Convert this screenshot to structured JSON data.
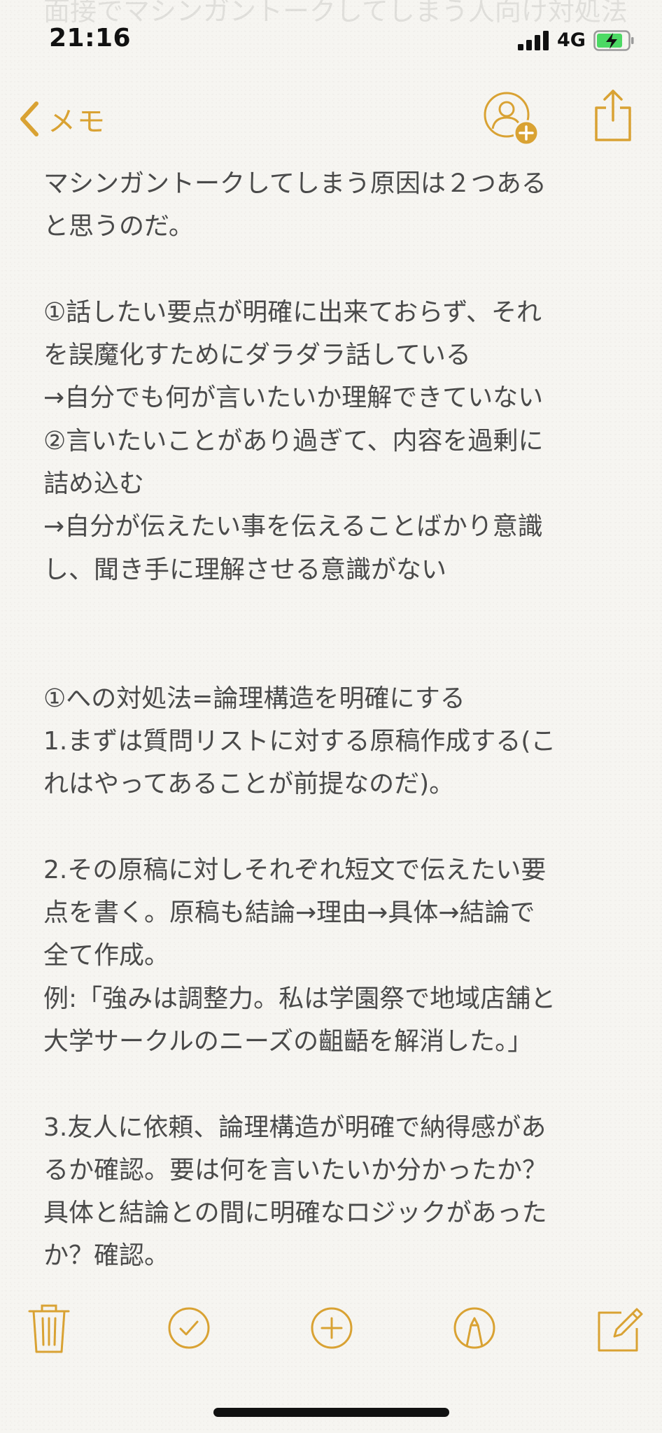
{
  "background_title": "面接でマシンガントークしてしまう人向け対処法",
  "status_bar": {
    "time": "21:16",
    "network": "4G"
  },
  "nav": {
    "back_label": "メモ",
    "accent_color": "#d9a233"
  },
  "note": {
    "lines": [
      "マシンガントークしてしまう原因は２つある",
      "と思うのだ。",
      "",
      "①話したい要点が明確に出来ておらず、それ",
      "を誤魔化すためにダラダラ話している",
      "→自分でも何が言いたいか理解できていない",
      "②言いたいことがあり過ぎて、内容を過剰に",
      "詰め込む",
      "→自分が伝えたい事を伝えることばかり意識",
      "し、聞き手に理解させる意識がない",
      "",
      "",
      "①への対処法=論理構造を明確にする",
      "1.まずは質問リストに対する原稿作成する(こ",
      "れはやってあることが前提なのだ)。",
      "",
      "2.その原稿に対しそれぞれ短文で伝えたい要",
      "点を書く。原稿も結論→理由→具体→結論で",
      "全て作成。",
      "例:「強みは調整力。私は学園祭で地域店舗と",
      "大学サークルのニーズの齟齬を解消した。」",
      "",
      "3.友人に依頼、論理構造が明確で納得感があ",
      "るか確認。要は何を言いたいか分かったか？",
      "具体と結論との間に明確なロジックがあった",
      "か？確認。"
    ]
  },
  "toolbar": {
    "icons": [
      "trash-icon",
      "checklist-icon",
      "add-icon",
      "markup-icon",
      "compose-icon"
    ]
  }
}
